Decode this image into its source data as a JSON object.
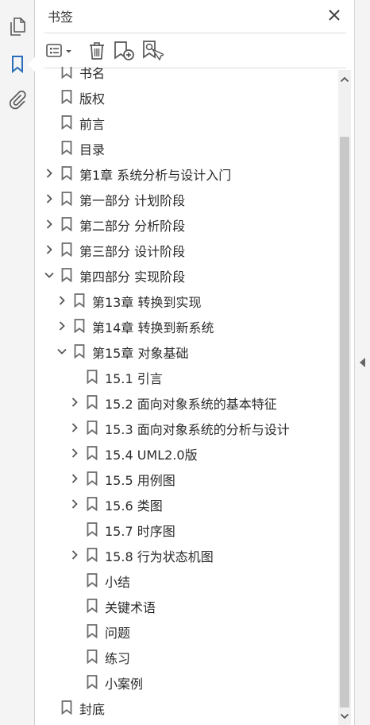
{
  "panel": {
    "title": "书签"
  },
  "tree": {
    "items": [
      {
        "label": "书名"
      },
      {
        "label": "版权"
      },
      {
        "label": "前言"
      },
      {
        "label": "目录"
      },
      {
        "label": "第1章  系统分析与设计入门"
      },
      {
        "label": "第一部分  计划阶段"
      },
      {
        "label": "第二部分  分析阶段"
      },
      {
        "label": "第三部分  设计阶段"
      },
      {
        "label": "第四部分  实现阶段"
      },
      {
        "label": "第13章  转换到实现"
      },
      {
        "label": "第14章  转换到新系统"
      },
      {
        "label": "第15章  对象基础"
      },
      {
        "label": "15.1  引言"
      },
      {
        "label": "15.2  面向对象系统的基本特征"
      },
      {
        "label": "15.3  面向对象系统的分析与设计"
      },
      {
        "label": "15.4  UML2.0版"
      },
      {
        "label": "15.5  用例图"
      },
      {
        "label": "15.6  类图"
      },
      {
        "label": "15.7  时序图"
      },
      {
        "label": "15.8  行为状态机图"
      },
      {
        "label": "小结"
      },
      {
        "label": "关键术语"
      },
      {
        "label": "问题"
      },
      {
        "label": "练习"
      },
      {
        "label": "小案例"
      },
      {
        "label": "封底"
      }
    ]
  },
  "icons": {
    "rail": [
      "pages-icon",
      "bookmark-icon",
      "attachment-icon"
    ],
    "toolbar": [
      "options-menu-icon",
      "delete-icon",
      "new-bookmark-icon",
      "bookmark-from-selection-icon"
    ]
  },
  "colors": {
    "accent": "#2a6ebb",
    "icon": "#555555",
    "bookmark": "#6b6b6b"
  }
}
